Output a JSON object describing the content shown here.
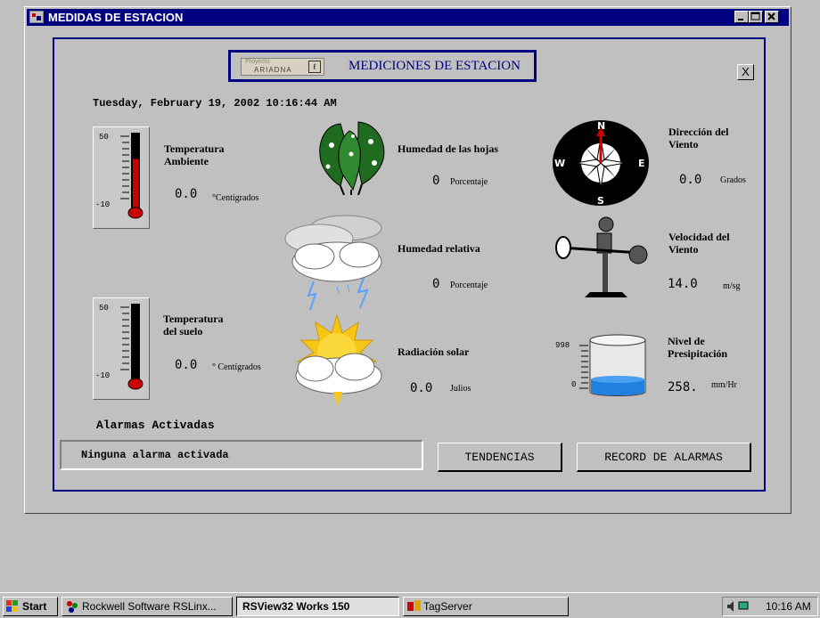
{
  "window": {
    "title": "MEDIDAS DE ESTACION"
  },
  "header": {
    "logo_line1": "Proyecto",
    "logo_line2": "ARIADNA",
    "title": "MEDICIONES DE ESTACION",
    "close_label": "X"
  },
  "datetime": "Tuesday, February 19, 2002   10:16:44 AM",
  "ambient_temp": {
    "label_line1": "Temperatura",
    "label_line2": "Ambiente",
    "value": "0.0",
    "unit": "°Centígrados",
    "scale_max": "50",
    "scale_min": "-10",
    "level_percent": 68
  },
  "soil_temp": {
    "label_line1": "Temperatura",
    "label_line2": "del suelo",
    "value": "0.0",
    "unit": "° Centígrados",
    "scale_max": "50",
    "scale_min": "-10",
    "level_percent": 0
  },
  "leaf_humidity": {
    "label": "Humedad de las hojas",
    "value": "0",
    "unit": "Porcentaje"
  },
  "relative_humidity": {
    "label": "Humedad relativa",
    "value": "0",
    "unit": "Porcentaje"
  },
  "solar_radiation": {
    "label": "Radiación solar",
    "value": "0.0",
    "unit": "Julios"
  },
  "wind_direction": {
    "label_line1": "Dirección del",
    "label_line2": "Viento",
    "value": "0.0",
    "unit": "Grados",
    "compass": {
      "n": "N",
      "s": "S",
      "e": "E",
      "w": "W"
    }
  },
  "wind_speed": {
    "label_line1": "Velocidad del",
    "label_line2": "Viento",
    "value": "14.0",
    "unit": "m/sg"
  },
  "precipitation": {
    "label_line1": "Nivel de",
    "label_line2": "Presipitación",
    "value": "258.",
    "unit": "mm/Hr",
    "scale_max": "998",
    "scale_min": "0",
    "level_percent": 26
  },
  "alarms": {
    "heading": "Alarmas Activadas",
    "status": "Ninguna alarma activada"
  },
  "buttons": {
    "trends": "TENDENCIAS",
    "alarm_record": "RECORD DE ALARMAS"
  },
  "taskbar": {
    "start": "Start",
    "items": [
      {
        "label": "Rockwell Software RSLinx..."
      },
      {
        "label": "RSView32 Works 150"
      },
      {
        "label": "TagServer"
      }
    ],
    "clock": "10:16 AM"
  },
  "colors": {
    "title_bar": "#000080",
    "panel_border": "#000080",
    "water": "#2080e0",
    "mercury": "#cc0000"
  }
}
